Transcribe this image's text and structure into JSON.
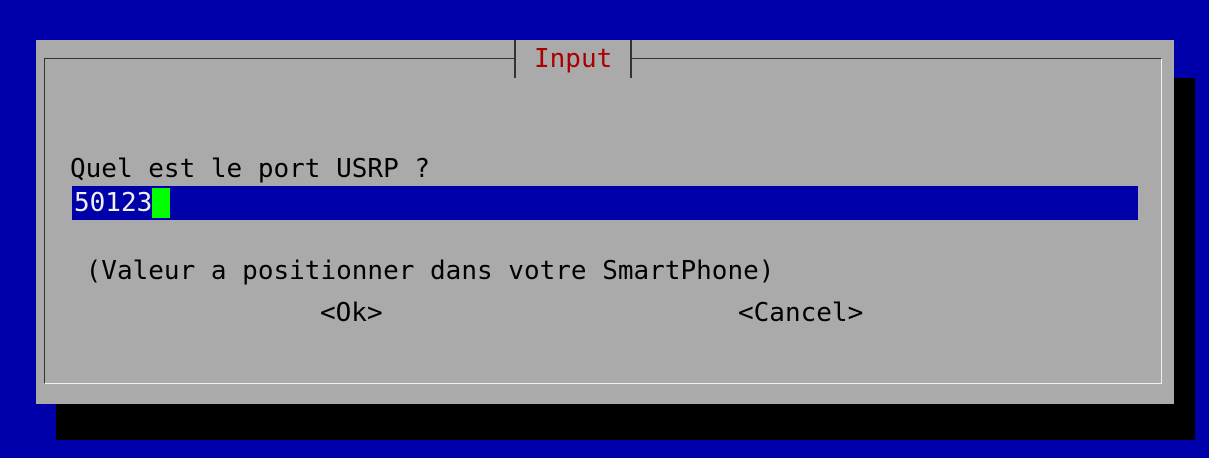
{
  "dialog": {
    "title": "Input",
    "prompt_line1": "Quel est le port USRP ?",
    "prompt_line2": " (Valeur a positionner dans votre SmartPhone)",
    "input_value": "50123",
    "ok_label": "<Ok>",
    "cancel_label": "<Cancel>"
  },
  "colors": {
    "background": "#0000aa",
    "dialog": "#aaaaaa",
    "title": "#aa0000",
    "input_bg": "#0000aa",
    "cursor": "#00ff00",
    "shadow": "#000000"
  }
}
